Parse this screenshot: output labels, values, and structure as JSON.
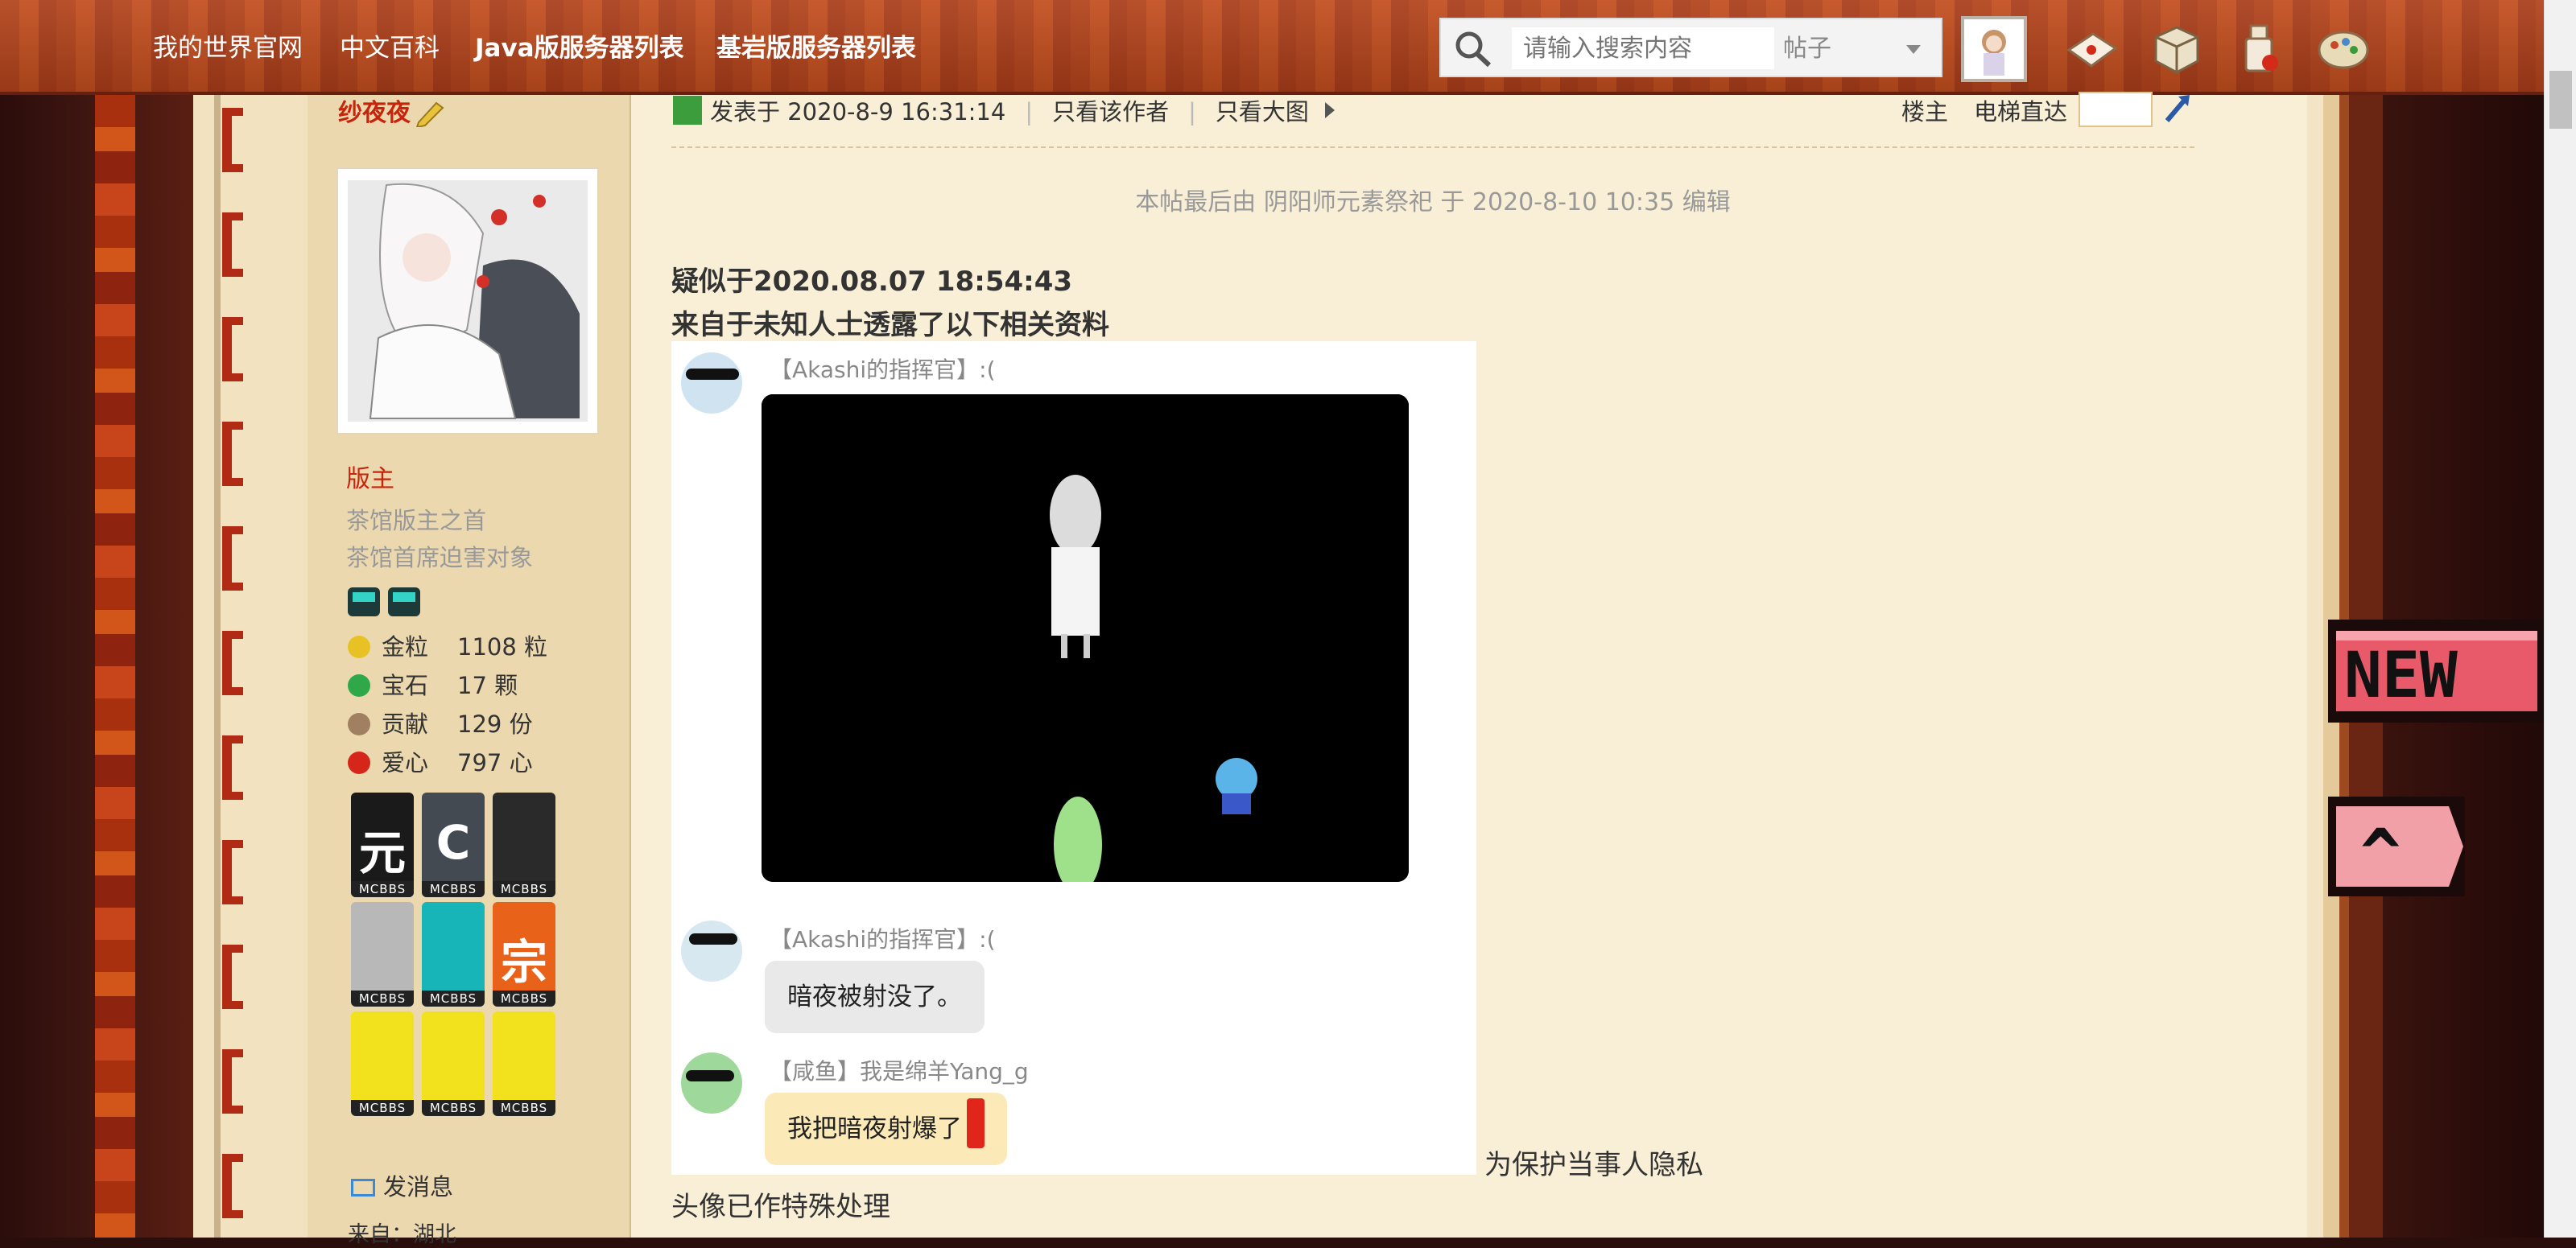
{
  "nav": {
    "links": [
      "我的世界官网",
      "中文百科",
      "Java版服务器列表",
      "基岩版服务器列表"
    ]
  },
  "search": {
    "placeholder": "请输入搜索内容",
    "type": "帖子"
  },
  "sidebar": {
    "author": "纱夜夜",
    "group": "版主",
    "titles": [
      "茶馆版主之首",
      "茶馆首席迫害对象"
    ],
    "stats": [
      {
        "label": "金粒",
        "value": "1108 粒",
        "icon": "gold-nugget-icon",
        "color": "#e8c224"
      },
      {
        "label": "宝石",
        "value": "17 颗",
        "icon": "emerald-icon",
        "color": "#2fa84a"
      },
      {
        "label": "贡献",
        "value": "129 份",
        "icon": "contribution-icon",
        "color": "#a08060"
      },
      {
        "label": "爱心",
        "value": "797 心",
        "icon": "apple-heart-icon",
        "color": "#d6261a"
      }
    ],
    "medals": [
      {
        "glyph": "元",
        "bg": "#1a1a1a"
      },
      {
        "glyph": "C",
        "bg": "#444a52"
      },
      {
        "glyph": "",
        "bg": "#2a2a2a"
      },
      {
        "glyph": "",
        "bg": "#b8b8b8"
      },
      {
        "glyph": "",
        "bg": "#17b5b8"
      },
      {
        "glyph": "宗",
        "bg": "#e8621a"
      },
      {
        "glyph": "",
        "bg": "#f1e21d"
      },
      {
        "glyph": "",
        "bg": "#f1e21d"
      },
      {
        "glyph": "",
        "bg": "#f1e21d"
      }
    ],
    "medal_tag": "MCBBS",
    "send_message": "发消息",
    "from": "来自：湖北"
  },
  "post": {
    "posted_at": "发表于 2020-8-9 16:31:14",
    "only_author": "只看该作者",
    "big_image": "只看大图",
    "floor": "楼主",
    "elevator": "电梯直达",
    "edit_note": "本帖最后由 阴阳师元素祭祀 于 2020-8-10 10:35 编辑",
    "line1": "疑似于2020.08.07 18:54:43",
    "line2": "来自于未知人士透露了以下相关资料",
    "privacy_note": "为保护当事人隐私",
    "avatar_note": "头像已作特殊处理"
  },
  "chat": {
    "sender1": "【Akashi的指挥官】:(",
    "sender2": "【Akashi的指挥官】:(",
    "message2": "暗夜被射没了。",
    "sender3": "【咸鱼】我是绵羊Yang_g",
    "message3": "我把暗夜射爆了"
  },
  "floating": {
    "new_label": "NEW",
    "up_label": "^"
  }
}
